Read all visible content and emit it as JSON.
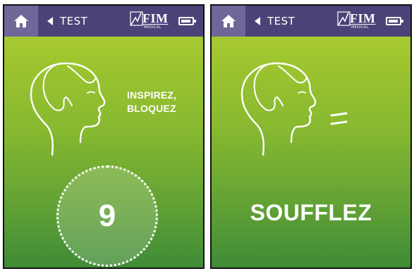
{
  "screens": [
    {
      "back_label": "TEST",
      "brand_name": "FIM",
      "brand_subtitle": "MEDICAL",
      "icons": {
        "home": "home-icon",
        "back": "chevron-left-icon",
        "battery": "battery-icon",
        "illustration": "head-profile-icon"
      },
      "instruction": [
        "INSPIREZ,",
        "BLOQUEZ"
      ],
      "countdown": "9"
    },
    {
      "back_label": "TEST",
      "brand_name": "FIM",
      "brand_subtitle": "MEDICAL",
      "icons": {
        "home": "home-icon",
        "back": "chevron-left-icon",
        "battery": "battery-icon",
        "illustration": "head-profile-icon",
        "exhale": "exhale-lines-icon"
      },
      "message": "SOUFFLEZ"
    }
  ],
  "colors": {
    "header_background": "#4b4378",
    "home_button_background": "#6e6899",
    "screen_gradient_top": "#b4d033",
    "screen_gradient_bottom": "#3f8b36",
    "text": "#ffffff"
  }
}
